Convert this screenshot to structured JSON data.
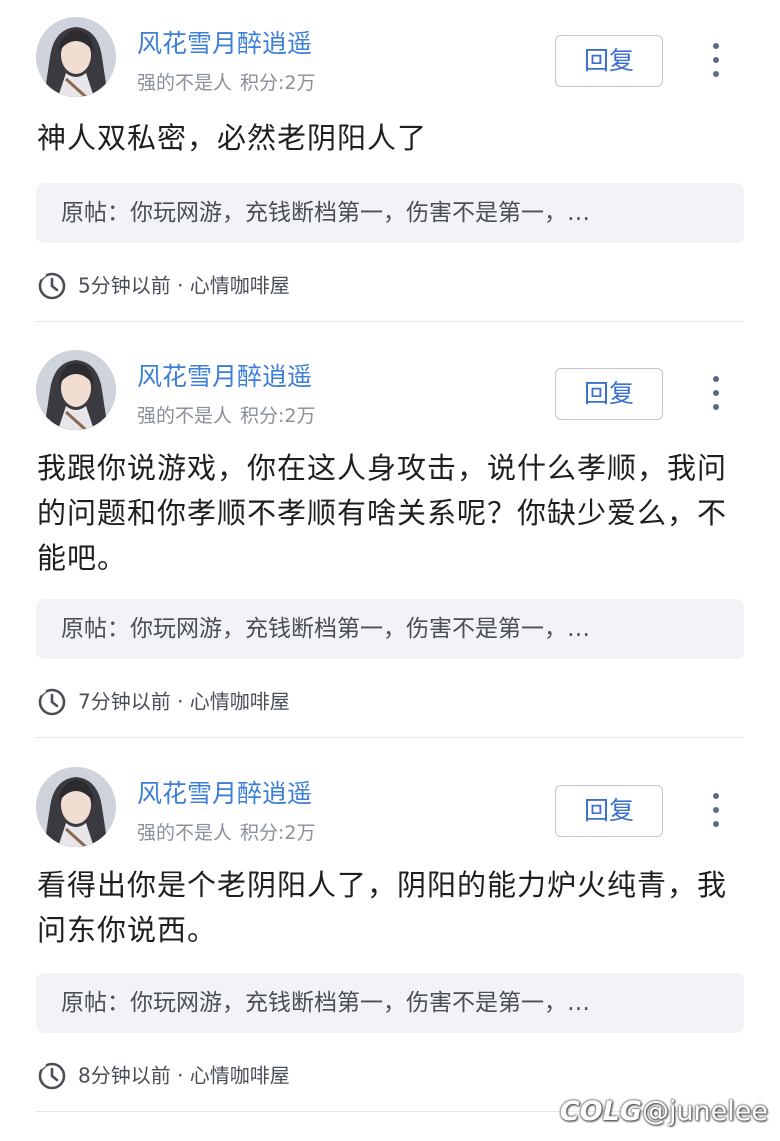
{
  "posts": [
    {
      "username": "风花雪月醉逍遥",
      "rank": "强的不是人",
      "score": "积分:2万",
      "reply_label": "回复",
      "content": "神人双私密，必然老阴阳人了",
      "quote": "原帖：你玩网游，充钱断档第一，伤害不是第一，…",
      "time": "5分钟以前 · 心情咖啡屋"
    },
    {
      "username": "风花雪月醉逍遥",
      "rank": "强的不是人",
      "score": "积分:2万",
      "reply_label": "回复",
      "content": "我跟你说游戏，你在这人身攻击，说什么孝顺，我问的问题和你孝顺不孝顺有啥关系呢？你缺少爱么，不能吧。",
      "quote": "原帖：你玩网游，充钱断档第一，伤害不是第一，…",
      "time": "7分钟以前 · 心情咖啡屋"
    },
    {
      "username": "风花雪月醉逍遥",
      "rank": "强的不是人",
      "score": "积分:2万",
      "reply_label": "回复",
      "content": "看得出你是个老阴阳人了，阴阳的能力炉火纯青，我问东你说西。",
      "quote": "原帖：你玩网游，充钱断档第一，伤害不是第一，…",
      "time": "8分钟以前 · 心情咖啡屋"
    }
  ],
  "watermark": {
    "logo": "COLG",
    "handle": "@junelee"
  },
  "icons": {
    "more": "vertical-dots-icon",
    "clock": "clock-icon"
  },
  "colors": {
    "username": "#3d7fd8",
    "reply_text": "#3c6fd0",
    "quote_bg": "#f2f3f6"
  }
}
